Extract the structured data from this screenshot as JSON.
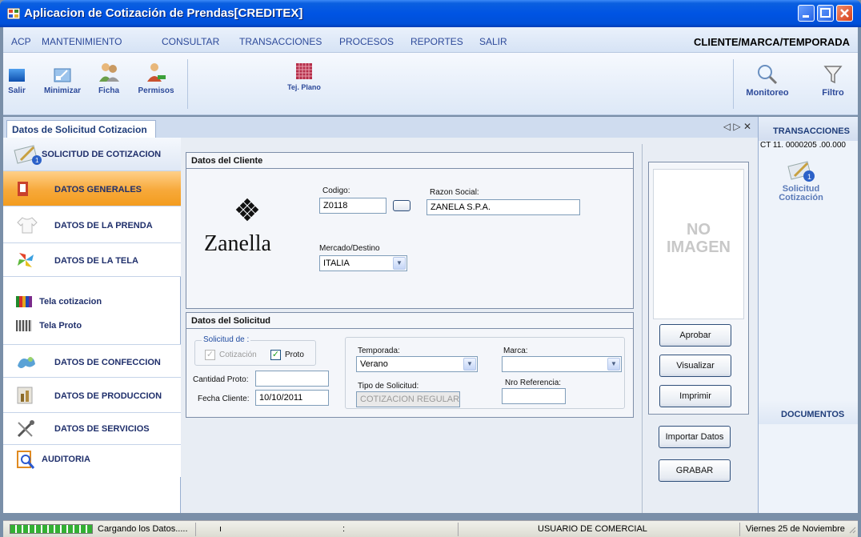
{
  "window": {
    "title": "Aplicacion de Cotización de Prendas[CREDITEX]"
  },
  "menu": {
    "items": [
      "ACP",
      "MANTENIMIENTO",
      "CONSULTAR",
      "TRANSACCIONES",
      "PROCESOS",
      "REPORTES",
      "SALIR"
    ],
    "context": "CLIENTE/MARCA/TEMPORADA"
  },
  "toolbar": {
    "salir": "Salir",
    "minimizar": "Minimizar",
    "ficha": "Ficha",
    "permisos": "Permisos",
    "tej_plano": "Tej. Plano",
    "monitoreo": "Monitoreo",
    "filtro": "Filtro"
  },
  "tab": {
    "label": "Datos de Solicitud Cotizacion",
    "controls": "◁ ▷ ✕"
  },
  "nav": {
    "header": "SOLICITUD DE COTIZACION",
    "items": [
      "DATOS GENERALES",
      "DATOS DE LA PRENDA",
      "DATOS DE LA TELA"
    ],
    "subitems": [
      "Tela cotizacion",
      "Tela Proto"
    ],
    "items2": [
      "DATOS DE CONFECCION",
      "DATOS DE PRODUCCION",
      "DATOS DE SERVICIOS",
      "AUDITORIA"
    ]
  },
  "cliente": {
    "title": "Datos del Cliente",
    "logo": "Zanella",
    "codigo_label": "Codigo:",
    "codigo": "Z0118",
    "razon_label": "Razon Social:",
    "razon": "ZANELA S.P.A.",
    "mercado_label": "Mercado/Destino",
    "mercado": "ITALIA"
  },
  "solicitud": {
    "title": "Datos del Solicitud",
    "solicitud_de": "Solicitud de :",
    "cotizacion": "Cotización",
    "proto": "Proto",
    "cantidad_label": "Cantidad Proto:",
    "cantidad": "",
    "fecha_label": "Fecha Cliente:",
    "fecha": "10/10/2011",
    "temporada_label": "Temporada:",
    "temporada": "Verano",
    "marca_label": "Marca:",
    "marca": "",
    "tipo_label": "Tipo de Solicitud:",
    "tipo": "COTIZACION REGULAR",
    "nro_label": "Nro Referencia:",
    "nro": ""
  },
  "image": {
    "placeholder_line1": "NO",
    "placeholder_line2": "IMAGEN"
  },
  "buttons": {
    "aprobar": "Aprobar",
    "visualizar": "Visualizar",
    "imprimir": "Imprimir",
    "importar": "Importar Datos",
    "grabar": "GRABAR"
  },
  "right": {
    "transacciones": "TRANSACCIONES",
    "code": "CT 11. 0000205 .00.000",
    "item_label_1": "Solicitud",
    "item_label_2": "Cotización",
    "documentos": "DOCUMENTOS"
  },
  "status": {
    "loading": "Cargando los Datos.....",
    "mid1": "ı",
    "mid2": ":",
    "user": "USUARIO DE  COMERCIAL",
    "date": "Viernes 25 de Noviembre"
  },
  "colors": {
    "titlebar": "#0054e3",
    "active_nav": "#f7a93a",
    "menu_text": "#2d4a9a"
  }
}
